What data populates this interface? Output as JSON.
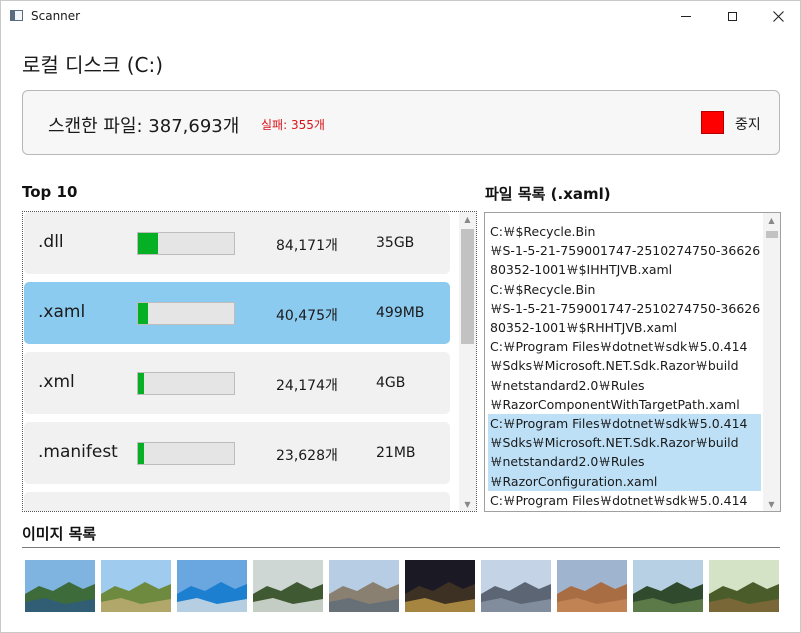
{
  "window": {
    "title": "Scanner"
  },
  "drive_title": "로컬 디스크 (C:)",
  "scan": {
    "files_label": "스캔한 파일: 387,693개",
    "fail_label": "실패: 355개",
    "stop_label": "중지",
    "stop_color": "#ff0000"
  },
  "top10": {
    "title": "Top 10",
    "rows": [
      {
        "ext": ".dll",
        "count": "84,171개",
        "size": "35GB",
        "ratio": 0.21
      },
      {
        "ext": ".xaml",
        "count": "40,475개",
        "size": "499MB",
        "ratio": 0.1
      },
      {
        "ext": ".xml",
        "count": "24,174개",
        "size": "4GB",
        "ratio": 0.06
      },
      {
        "ext": ".manifest",
        "count": "23,628개",
        "size": "21MB",
        "ratio": 0.06
      }
    ],
    "selected_index": 1
  },
  "files": {
    "title": "파일 목록 (.xaml)",
    "entries": [
      "C:\\$Recycle.Bin\\S-1-5-21-759001747-2510274750-3662680352-1001\\$IHHTJVB.xaml",
      "C:\\$Recycle.Bin\\S-1-5-21-759001747-2510274750-3662680352-1001\\$RHHTJVB.xaml",
      "C:\\Program Files\\dotnet\\sdk\\5.0.414\\Sdks\\Microsoft.NET.Sdk.Razor\\build\\netstandard2.0\\Rules\\RazorComponentWithTargetPath.xaml",
      "C:\\Program Files\\dotnet\\sdk\\5.0.414\\Sdks\\Microsoft.NET.Sdk.Razor\\build\\netstandard2.0\\Rules\\RazorConfiguration.xaml",
      "C:\\Program Files\\dotnet\\sdk\\5.0.414"
    ],
    "entry_lines": [
      [
        "C:￦$Recycle.Bin",
        "￦S-1-5-21-759001747-2510274750-36626",
        "80352-1001￦$IHHTJVB.xaml"
      ],
      [
        "C:￦$Recycle.Bin",
        "￦S-1-5-21-759001747-2510274750-36626",
        "80352-1001￦$RHHTJVB.xaml"
      ],
      [
        "C:￦Program Files￦dotnet￦sdk￦5.0.414",
        "￦Sdks￦Microsoft.NET.Sdk.Razor￦build",
        "￦netstandard2.0￦Rules",
        "￦RazorComponentWithTargetPath.xaml"
      ],
      [
        "C:￦Program Files￦dotnet￦sdk￦5.0.414",
        "￦Sdks￦Microsoft.NET.Sdk.Razor￦build",
        "￦netstandard2.0￦Rules",
        "￦RazorConfiguration.xaml"
      ],
      [
        "C:￦Program Files￦dotnet￦sdk￦5.0.414"
      ]
    ],
    "selected_index": 3
  },
  "images": {
    "title": "이미지 목록",
    "thumbnails": [
      {
        "name": "palm-lake-thumbnail",
        "sky": "#7fb3e0",
        "ground": "#3d6b3a",
        "accent": "#2f5a8a"
      },
      {
        "name": "coast-cliffs-thumbnail",
        "sky": "#9fcbef",
        "ground": "#6d8a3f",
        "accent": "#c9b07a"
      },
      {
        "name": "aquarium-show-thumbnail",
        "sky": "#6aa6e0",
        "ground": "#1c7fd0",
        "accent": "#e8e8e8"
      },
      {
        "name": "waterfall-thumbnail",
        "sky": "#cfd7d4",
        "ground": "#3f5a33",
        "accent": "#f0f4f4"
      },
      {
        "name": "city-street-thumbnail",
        "sky": "#b7cde3",
        "ground": "#8a8072",
        "accent": "#5b6a7a"
      },
      {
        "name": "night-square-thumbnail",
        "sky": "#1b1a24",
        "ground": "#3d3124",
        "accent": "#c9a24a"
      },
      {
        "name": "skyline-thumbnail",
        "sky": "#c4d4e6",
        "ground": "#5b6574",
        "accent": "#8d9aab"
      },
      {
        "name": "canyon-thumbnail",
        "sky": "#9fb5cf",
        "ground": "#a86d43",
        "accent": "#c98b5a"
      },
      {
        "name": "forest-trail-thumbnail",
        "sky": "#b8d0e4",
        "ground": "#2f4a2c",
        "accent": "#6c8b50"
      },
      {
        "name": "cliff-vegetation-thumbnail",
        "sky": "#d4e3c6",
        "ground": "#4a5c2a",
        "accent": "#8a6b3c"
      }
    ]
  }
}
